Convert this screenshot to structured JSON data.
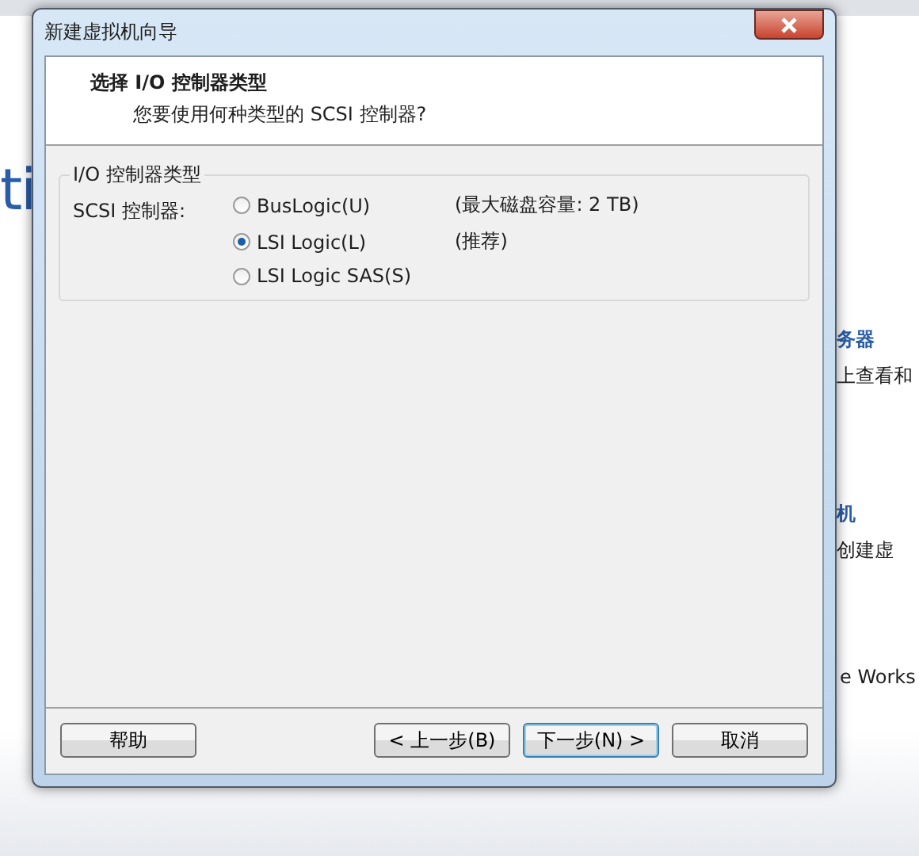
{
  "background": {
    "logo_fragment": "ti",
    "items": [
      {
        "title": "务器",
        "text": "上查看和"
      },
      {
        "title": "机",
        "text": "创建虚"
      }
    ],
    "footer_fragment": "e Works"
  },
  "window": {
    "title": "新建虚拟机向导"
  },
  "header": {
    "title": "选择 I/O 控制器类型",
    "subtitle": "您要使用何种类型的 SCSI 控制器?"
  },
  "group": {
    "title": "I/O 控制器类型",
    "label": "SCSI 控制器:",
    "options": [
      {
        "label": "BusLogic(U)",
        "note": "(最大磁盘容量: 2 TB)",
        "selected": false
      },
      {
        "label": "LSI Logic(L)",
        "note": "(推荐)",
        "selected": true
      },
      {
        "label": "LSI Logic SAS(S)",
        "selected": false
      }
    ]
  },
  "buttons": [
    {
      "label": "帮助",
      "kind": "help"
    },
    {
      "label": "< 上一步(B)",
      "kind": "nav"
    },
    {
      "label": "下一步(N) >",
      "kind": "default"
    },
    {
      "label": "取消",
      "kind": "nav"
    }
  ]
}
